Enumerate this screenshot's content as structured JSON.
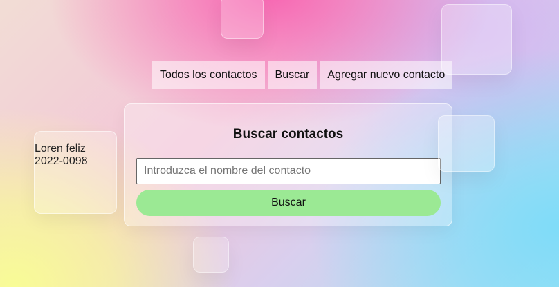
{
  "nav": {
    "items": [
      {
        "label": "Todos los contactos"
      },
      {
        "label": "Buscar"
      },
      {
        "label": "Agregar nuevo contacto"
      }
    ]
  },
  "contact_card": {
    "name": "Loren feliz",
    "phone": "2022-0098"
  },
  "search_panel": {
    "title": "Buscar contactos",
    "input_value": "",
    "input_placeholder": "Introduzca el nombre del contacto",
    "button_label": "Buscar"
  },
  "colors": {
    "button_green": "#9be994",
    "background_pink": "#f766b2",
    "background_cyan": "#7fdcf8",
    "background_yellow": "#f8fc96"
  }
}
